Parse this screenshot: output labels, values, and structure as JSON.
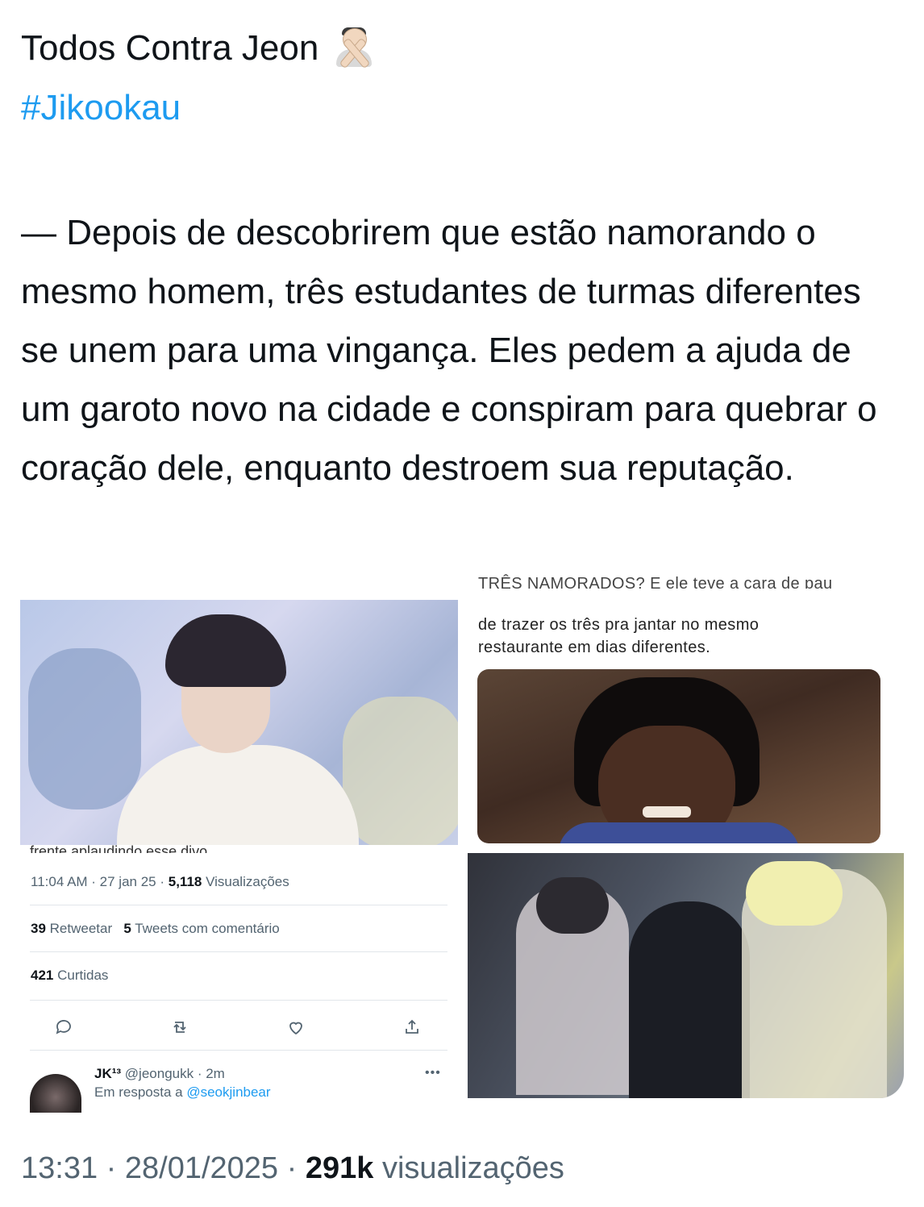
{
  "tweet": {
    "title": "Todos Contra Jeon",
    "emoji": "person-gesturing-no",
    "hashtag": "#Jikookau",
    "description": "— Depois de descobrirem que estão namorando o mesmo homem, três estudantes de turmas diferentes se unem para uma vingança. Eles pedem a ajuda de um garoto novo na cidade e conspiram para quebrar o coração dele, enquanto destroem sua reputação."
  },
  "media": {
    "caption_cutoff": "TRÊS NAMORADOS? E ele teve a cara de pau",
    "caption_line1": "de trazer os três pra jantar no mesmo",
    "caption_line2": "restaurante em dias diferentes.",
    "embed": {
      "cutoff_text": "frente aplaudindo esse divo.",
      "time": "11:04 AM · 27 jan 25 ·",
      "views_count": "5,118",
      "views_label": "Visualizações",
      "retweets_count": "39",
      "retweets_label": "Retweetar",
      "quotes_count": "5",
      "quotes_label": "Tweets com comentário",
      "likes_count": "421",
      "likes_label": "Curtidas",
      "reply": {
        "name": "JK¹³",
        "handle": "@jeongukk · 2m",
        "reply_prefix": "Em resposta a",
        "mention": "@seokjinbear",
        "more": "•••"
      }
    }
  },
  "footer": {
    "time": "13:31 · 28/01/2025 ·",
    "views_count": "291k",
    "views_label": "visualizações"
  },
  "colors": {
    "link": "#1d9bf0",
    "secondary": "#536471"
  }
}
